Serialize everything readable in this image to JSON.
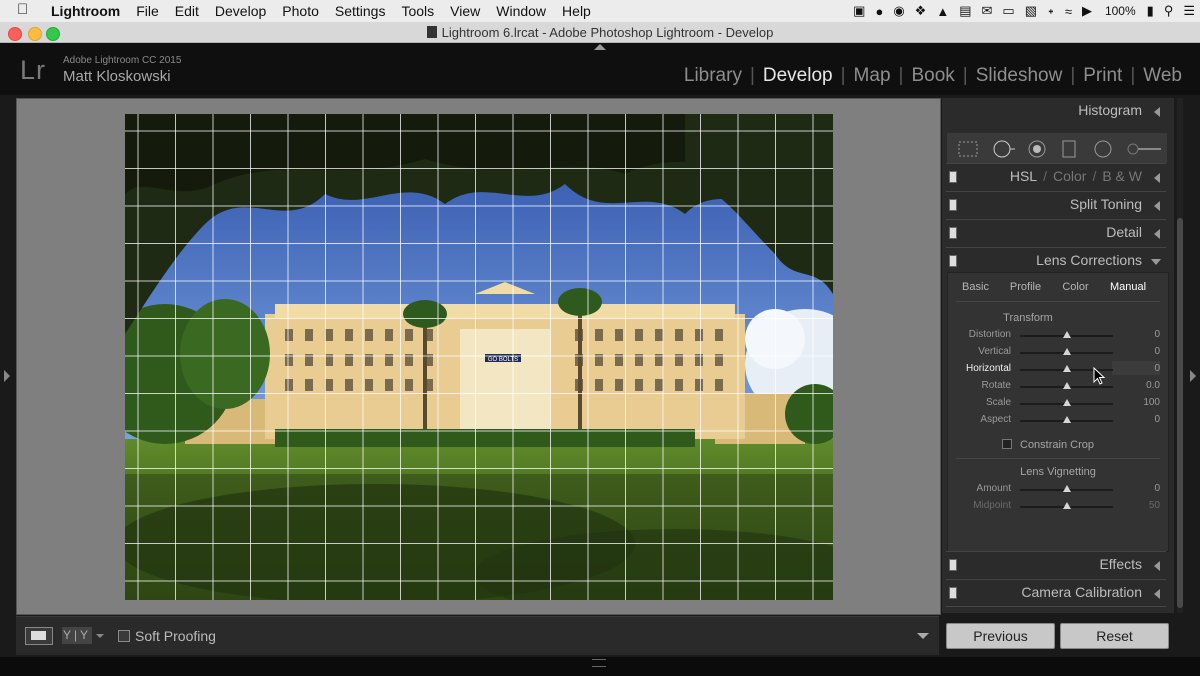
{
  "menubar": {
    "app_name": "Lightroom",
    "items": [
      "File",
      "Edit",
      "Develop",
      "Photo",
      "Settings",
      "Tools",
      "View",
      "Window",
      "Help"
    ],
    "battery": "100%"
  },
  "window": {
    "title": "Lightroom 6.lrcat - Adobe Photoshop Lightroom - Develop"
  },
  "header": {
    "logo": "Lr",
    "version": "Adobe Lightroom CC 2015",
    "user": "Matt Kloskowski",
    "nav": [
      {
        "label": "Library"
      },
      {
        "label": "Develop",
        "active": true
      },
      {
        "label": "Map"
      },
      {
        "label": "Book"
      },
      {
        "label": "Slideshow"
      },
      {
        "label": "Print"
      },
      {
        "label": "Web"
      }
    ]
  },
  "photo": {
    "sign_text": "GO BOLTS"
  },
  "toolbar": {
    "yy_label": "Y|Y",
    "soft_proofing": "Soft Proofing"
  },
  "right_panel": {
    "histogram": "Histogram",
    "hsl": {
      "hsl": "HSL",
      "color": "Color",
      "bw": "B & W",
      "sep": "/"
    },
    "split_toning": "Split Toning",
    "detail": "Detail",
    "lens_corrections": "Lens Corrections",
    "lens_tabs": [
      "Basic",
      "Profile",
      "Color",
      "Manual"
    ],
    "selected_tab": "Manual",
    "transform_title": "Transform",
    "transform_sliders": [
      {
        "label": "Distortion",
        "value": "0",
        "position": 0.5
      },
      {
        "label": "Vertical",
        "value": "0",
        "position": 0.5
      },
      {
        "label": "Horizontal",
        "value": "0",
        "position": 0.5,
        "active": true
      },
      {
        "label": "Rotate",
        "value": "0.0",
        "position": 0.5
      },
      {
        "label": "Scale",
        "value": "100",
        "position": 0.5
      },
      {
        "label": "Aspect",
        "value": "0",
        "position": 0.5
      }
    ],
    "constrain_crop": "Constrain Crop",
    "vignetting_title": "Lens Vignetting",
    "vignetting_sliders": [
      {
        "label": "Amount",
        "value": "0",
        "position": 0.5
      },
      {
        "label": "Midpoint",
        "value": "50",
        "position": 0.5,
        "dim": true
      }
    ],
    "effects": "Effects",
    "camera_calibration": "Camera Calibration"
  },
  "buttons": {
    "previous": "Previous",
    "reset": "Reset"
  },
  "colors": {
    "menubar_bg": "#ececec",
    "header_bg": "#0f0f0f",
    "panel_bg": "#2b2b2b",
    "canvas_bg": "#7f7f7f",
    "active_nav": "#e6e6e6"
  }
}
